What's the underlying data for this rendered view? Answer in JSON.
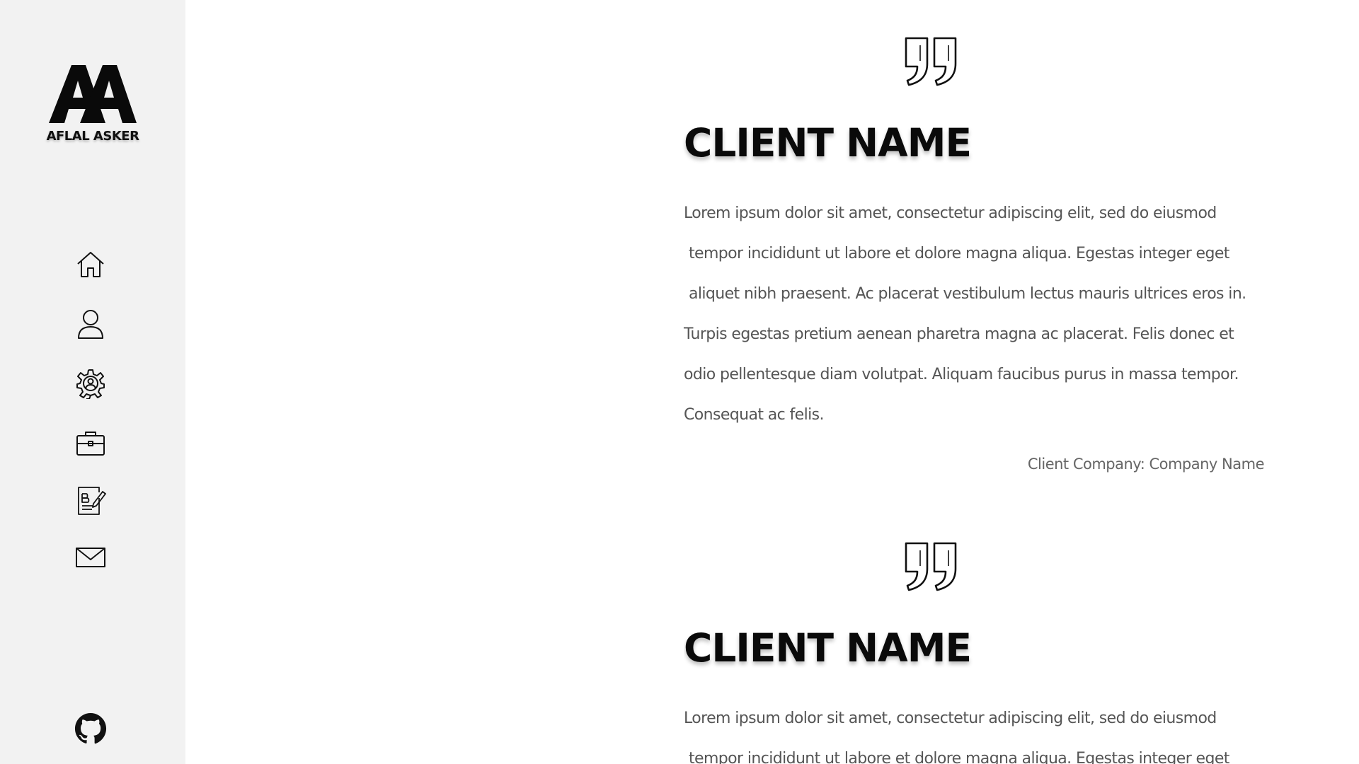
{
  "sidebar": {
    "logo_text": "AFLAL ASKER",
    "logo_mark": "AA",
    "nav": [
      {
        "icon": "home-icon"
      },
      {
        "icon": "user-icon"
      },
      {
        "icon": "gear-icon"
      },
      {
        "icon": "briefcase-icon"
      },
      {
        "icon": "blog-edit-icon"
      },
      {
        "icon": "mail-icon"
      }
    ],
    "footer_icon": "github-icon"
  },
  "testimonials": [
    {
      "quote_icon": "quote-icon",
      "client_name": "CLIENT NAME",
      "lines": [
        "Lorem ipsum dolor sit amet, consectetur adipiscing elit, sed do eiusmod",
        " tempor incididunt ut labore et dolore magna aliqua. Egestas integer eget",
        " aliquet nibh praesent. Ac placerat vestibulum lectus mauris ultrices eros in.",
        "Turpis egestas pretium aenean pharetra magna ac placerat. Felis donec et",
        "odio pellentesque diam volutpat. Aliquam faucibus purus in massa tempor.",
        "Consequat ac felis."
      ],
      "company": "Client Company: Company Name"
    },
    {
      "quote_icon": "quote-icon",
      "client_name": "CLIENT NAME",
      "lines": [
        "Lorem ipsum dolor sit amet, consectetur adipiscing elit, sed do eiusmod",
        " tempor incididunt ut labore et dolore magna aliqua. Egestas integer eget"
      ]
    }
  ]
}
